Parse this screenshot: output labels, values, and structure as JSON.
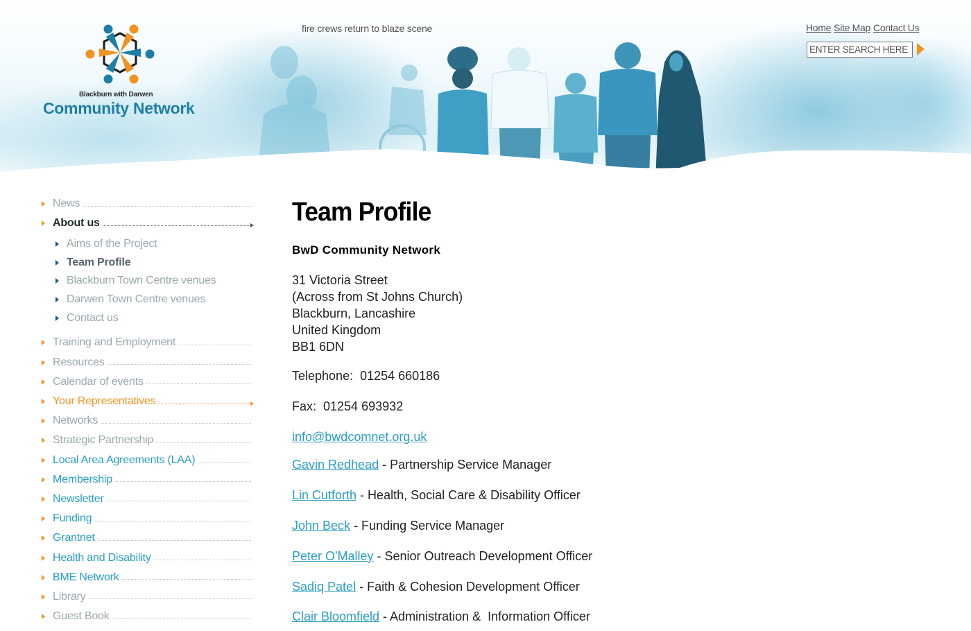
{
  "header": {
    "logo": {
      "subtitle": "Blackburn with Darwen",
      "title": "Community Network",
      "colors": {
        "blue": "#1e7fa6",
        "orange": "#f29322",
        "dark": "#1a1a1a"
      }
    },
    "ticker": "fire crews return to blaze scene",
    "top_links": [
      {
        "label": "Home"
      },
      {
        "label": "Site Map"
      },
      {
        "label": "Contact Us"
      }
    ],
    "search": {
      "placeholder": "ENTER SEARCH HERE",
      "value": "ENTER SEARCH HERE",
      "go_icon": "orange-triangle-arrow"
    }
  },
  "sidebar": {
    "items": [
      {
        "label": "News",
        "style": "grey"
      },
      {
        "label": "About us",
        "style": "dark",
        "active": true,
        "children": [
          {
            "label": "Aims of the Project"
          },
          {
            "label": "Team Profile",
            "current": true
          },
          {
            "label": "Blackburn Town Centre venues"
          },
          {
            "label": "Darwen Town Centre venues"
          },
          {
            "label": "Contact us"
          }
        ]
      },
      {
        "label": "Training and Employment",
        "style": "grey"
      },
      {
        "label": "Resources",
        "style": "grey"
      },
      {
        "label": "Calendar of events",
        "style": "grey"
      },
      {
        "label": "Your Representatives",
        "style": "orange",
        "highlight": true
      },
      {
        "label": "Networks",
        "style": "grey"
      },
      {
        "label": "Strategic Partnership",
        "style": "grey"
      },
      {
        "label": "Local Area Agreements (LAA)",
        "style": "blue"
      },
      {
        "label": "Membership",
        "style": "blue"
      },
      {
        "label": "Newsletter",
        "style": "blue"
      },
      {
        "label": "Funding",
        "style": "blue"
      },
      {
        "label": "Grantnet",
        "style": "blue"
      },
      {
        "label": "Health and Disability",
        "style": "blue"
      },
      {
        "label": "BME Network",
        "style": "blue"
      },
      {
        "label": "Library",
        "style": "grey"
      },
      {
        "label": "Guest Book",
        "style": "grey"
      }
    ]
  },
  "main": {
    "title": "Team Profile",
    "org_name": "BwD Community Network",
    "address": [
      "31 Victoria Street",
      "(Across from St Johns Church)",
      "Blackburn, Lancashire",
      "United Kingdom",
      "BB1 6DN"
    ],
    "telephone": "Telephone:  01254 660186",
    "fax": "Fax:  01254 693932",
    "email": "info@bwdcomnet.org.uk",
    "staff": [
      {
        "name": "Gavin Redhead",
        "role": " - Partnership Service Manager"
      },
      {
        "name": "Lin Cutforth",
        "role": " - Health, Social Care & Disability Officer"
      },
      {
        "name": "John Beck",
        "role": " - Funding Service Manager"
      },
      {
        "name": "Peter O'Malley",
        "role": " - Senior Outreach Development Officer"
      },
      {
        "name": "Sadiq Patel",
        "role": " - Faith & Cohesion Development Officer"
      },
      {
        "name": "Clair Bloomfield",
        "role": " - Administration &  Information Officer"
      }
    ]
  }
}
